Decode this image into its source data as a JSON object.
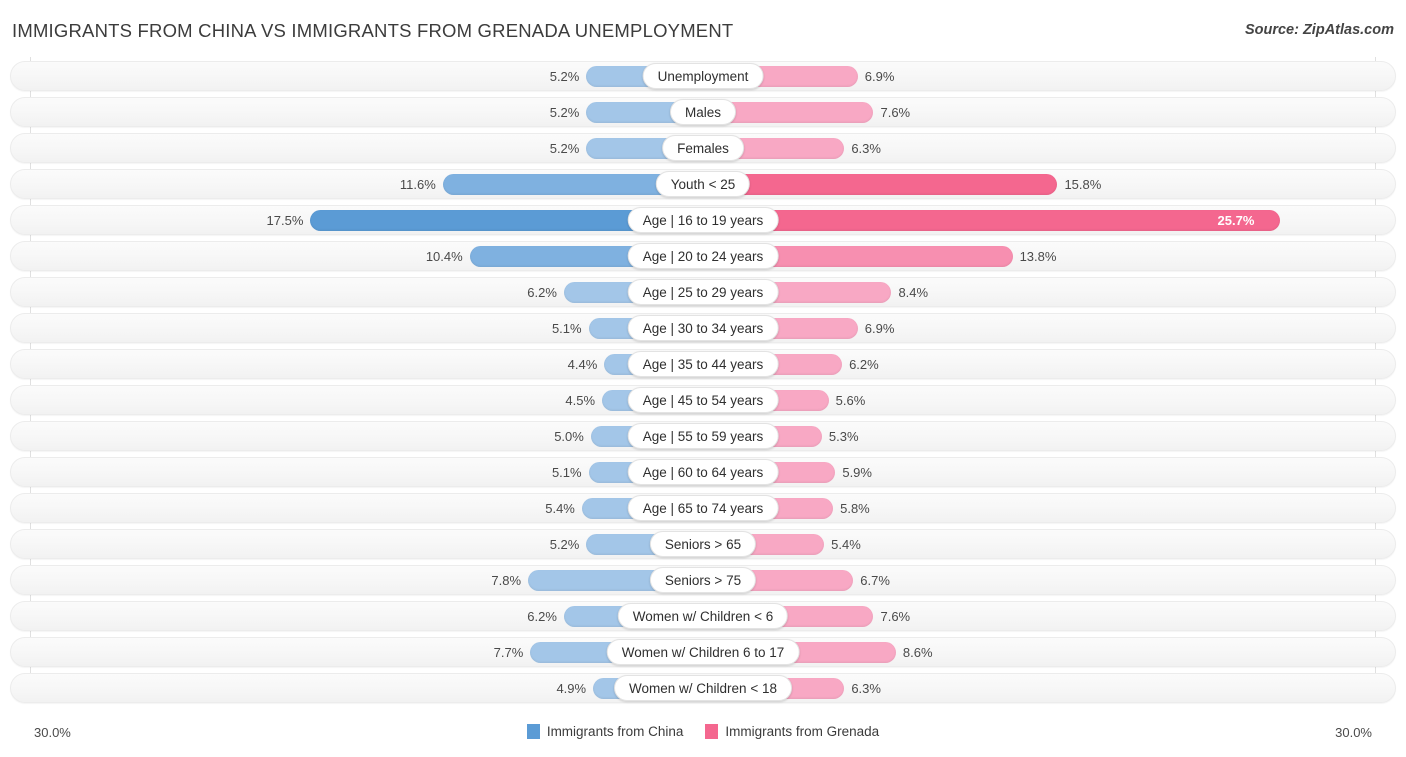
{
  "header": {
    "title": "IMMIGRANTS FROM CHINA VS IMMIGRANTS FROM GRENADA UNEMPLOYMENT",
    "source": "Source: ZipAtlas.com"
  },
  "axis": {
    "min_label": "30.0%",
    "max_label": "30.0%"
  },
  "legend": {
    "items": [
      {
        "label": "Immigrants from China",
        "color": "#5b9bd5"
      },
      {
        "label": "Immigrants from Grenada",
        "color": "#f4678f"
      }
    ]
  },
  "colors": {
    "left_light": "#a3c6e8",
    "left_mid": "#7fb1e0",
    "left_strong": "#5b9bd5",
    "right_light": "#f8a8c4",
    "right_mid": "#f78fb0",
    "right_strong": "#f4678f",
    "track": "#f7f7f7",
    "gridline": "#e0e0e0"
  },
  "chart_data": {
    "type": "bar",
    "orientation": "horizontal-diverging",
    "title": "IMMIGRANTS FROM CHINA VS IMMIGRANTS FROM GRENADA UNEMPLOYMENT",
    "xlabel": "",
    "ylabel": "",
    "xlim": [
      30.0,
      30.0
    ],
    "axis_max_percent": 30.0,
    "grid": true,
    "legend_position": "bottom-center",
    "categories": [
      "Unemployment",
      "Males",
      "Females",
      "Youth < 25",
      "Age | 16 to 19 years",
      "Age | 20 to 24 years",
      "Age | 25 to 29 years",
      "Age | 30 to 34 years",
      "Age | 35 to 44 years",
      "Age | 45 to 54 years",
      "Age | 55 to 59 years",
      "Age | 60 to 64 years",
      "Age | 65 to 74 years",
      "Seniors > 65",
      "Seniors > 75",
      "Women w/ Children < 6",
      "Women w/ Children 6 to 17",
      "Women w/ Children < 18"
    ],
    "series": [
      {
        "name": "Immigrants from China",
        "color": "#5b9bd5",
        "values": [
          5.2,
          5.2,
          5.2,
          11.6,
          17.5,
          10.4,
          6.2,
          5.1,
          4.4,
          4.5,
          5.0,
          5.1,
          5.4,
          5.2,
          7.8,
          6.2,
          7.7,
          4.9
        ],
        "labels": [
          "5.2%",
          "5.2%",
          "5.2%",
          "11.6%",
          "17.5%",
          "10.4%",
          "6.2%",
          "5.1%",
          "4.4%",
          "4.5%",
          "5.0%",
          "5.1%",
          "5.4%",
          "5.2%",
          "7.8%",
          "6.2%",
          "7.7%",
          "4.9%"
        ]
      },
      {
        "name": "Immigrants from Grenada",
        "color": "#f4678f",
        "values": [
          6.9,
          7.6,
          6.3,
          15.8,
          25.7,
          13.8,
          8.4,
          6.9,
          6.2,
          5.6,
          5.3,
          5.9,
          5.8,
          5.4,
          6.7,
          7.6,
          8.6,
          6.3
        ],
        "labels": [
          "6.9%",
          "7.6%",
          "6.3%",
          "15.8%",
          "25.7%",
          "13.8%",
          "8.4%",
          "6.9%",
          "6.2%",
          "5.6%",
          "5.3%",
          "5.9%",
          "5.8%",
          "5.4%",
          "6.7%",
          "7.6%",
          "8.6%",
          "6.3%"
        ]
      }
    ]
  }
}
